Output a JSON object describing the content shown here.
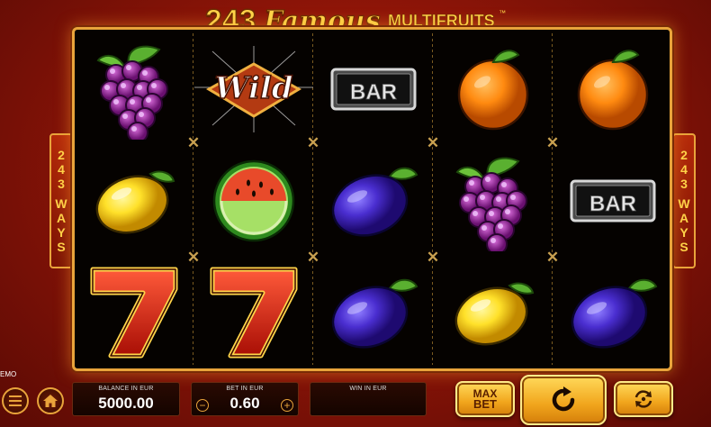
{
  "title": {
    "num": "243",
    "word": "Famous",
    "sub": "MULTIFRUITS",
    "tm": "™"
  },
  "ways": {
    "left": [
      "2",
      "4",
      "3",
      "W",
      "A",
      "Y",
      "S"
    ],
    "right": [
      "2",
      "4",
      "3",
      "W",
      "A",
      "Y",
      "S"
    ]
  },
  "reels": [
    [
      "grapes",
      "lemon",
      "seven"
    ],
    [
      "wild",
      "watermelon",
      "seven"
    ],
    [
      "bar",
      "plum",
      "plum"
    ],
    [
      "orange",
      "grapes",
      "lemon"
    ],
    [
      "orange",
      "bar",
      "plum"
    ]
  ],
  "symbols": {
    "wild_text": "Wild",
    "bar_text": "BAR"
  },
  "mode": "EMO",
  "balance": {
    "label": "BALANCE IN EUR",
    "value": "5000.00"
  },
  "bet": {
    "label": "BET IN EUR",
    "value": "0.60",
    "minus": "−",
    "plus": "+"
  },
  "win": {
    "label": "WIN IN EUR",
    "value": ""
  },
  "buttons": {
    "max_bet_line1": "MAX",
    "max_bet_line2": "BET"
  },
  "icons": [
    "menu-icon",
    "home-icon",
    "spin-icon",
    "autoplay-icon"
  ],
  "colors": {
    "gold": "#e9a43b",
    "background": "#8e1508"
  }
}
